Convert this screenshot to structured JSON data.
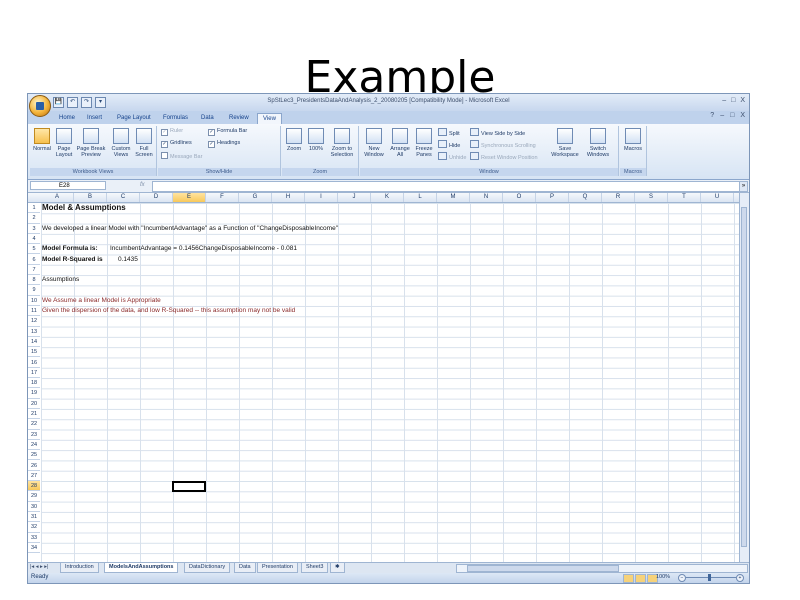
{
  "slide": {
    "title": "Example"
  },
  "window": {
    "doc_title": "SpStLec3_PresidentsDataAndAnalysis_2_20080205  [Compatibility Mode] - Microsoft Excel",
    "controls": [
      "–",
      "□",
      "X"
    ],
    "qat": [
      "💾",
      "↶",
      "↷",
      "▾"
    ]
  },
  "ribbon_tabs": [
    "Home",
    "Insert",
    "Page Layout",
    "Formulas",
    "Data",
    "Review",
    "View"
  ],
  "ribbon_right": [
    "?",
    "–",
    "□",
    "X"
  ],
  "ribbon": {
    "workbook_views": {
      "label": "Workbook Views",
      "buttons": [
        "Normal",
        "Page Layout",
        "Page Break Preview",
        "Custom Views",
        "Full Screen"
      ]
    },
    "show_hide": {
      "label": "Show/Hide",
      "checks": [
        {
          "label": "Ruler",
          "checked": true,
          "disabled": true
        },
        {
          "label": "Formula Bar",
          "checked": true,
          "disabled": false
        },
        {
          "label": "Gridlines",
          "checked": true,
          "disabled": false
        },
        {
          "label": "Headings",
          "checked": true,
          "disabled": false
        },
        {
          "label": "Message Bar",
          "checked": false,
          "disabled": true
        }
      ]
    },
    "zoom": {
      "label": "Zoom",
      "buttons": [
        "Zoom",
        "100%",
        "Zoom to Selection"
      ]
    },
    "window": {
      "label": "Window",
      "buttons": [
        "New Window",
        "Arrange All",
        "Freeze Panes"
      ],
      "small": [
        "Split",
        "Hide",
        "Unhide",
        "View Side by Side",
        "Synchronous Scrolling",
        "Reset Window Position"
      ],
      "buttons2": [
        "Save Workspace",
        "Switch Windows"
      ]
    },
    "macros": {
      "label": "Macros",
      "buttons": [
        "Macros"
      ]
    }
  },
  "formula_bar": {
    "name_box": "E28",
    "fx": "fx",
    "content": ""
  },
  "columns": [
    "A",
    "B",
    "C",
    "D",
    "E",
    "F",
    "G",
    "H",
    "I",
    "J",
    "K",
    "L",
    "M",
    "N",
    "O",
    "P",
    "Q",
    "R",
    "S",
    "T",
    "U"
  ],
  "selected_column": "E",
  "rows": [
    "1",
    "2",
    "3",
    "4",
    "5",
    "6",
    "7",
    "8",
    "9",
    "10",
    "11",
    "12",
    "13",
    "14",
    "15",
    "16",
    "17",
    "18",
    "19",
    "20",
    "21",
    "22",
    "23",
    "24",
    "25",
    "26",
    "27",
    "28",
    "29",
    "30",
    "31",
    "32",
    "33",
    "34"
  ],
  "selected_row": "28",
  "cells": {
    "r1": "Model & Assumptions",
    "r3": "We developed a linear Model with \"IncumbentAdvantage\" as a Function of \"ChangeDisposableIncome\"",
    "r5_label": "Model Formula is:",
    "r5_value": "IncumbentAdvantage = 0.1456ChangeDisposableIncome - 0.081",
    "r6_label": "Model R-Squared is",
    "r6_value": "0.1435",
    "r8": "Assumptions",
    "r10": "We Assume a linear Model is Appropriate",
    "r11": "Given the dispersion of the data, and low R-Squared -- this assumption may not be valid"
  },
  "sheet_tabs": [
    "Introduction",
    "ModelsAndAssumptions",
    "DataDictionary",
    "Data",
    "Presentation",
    "Sheet3"
  ],
  "active_sheet": "ModelsAndAssumptions",
  "status": {
    "text": "Ready",
    "zoom": "100%"
  }
}
